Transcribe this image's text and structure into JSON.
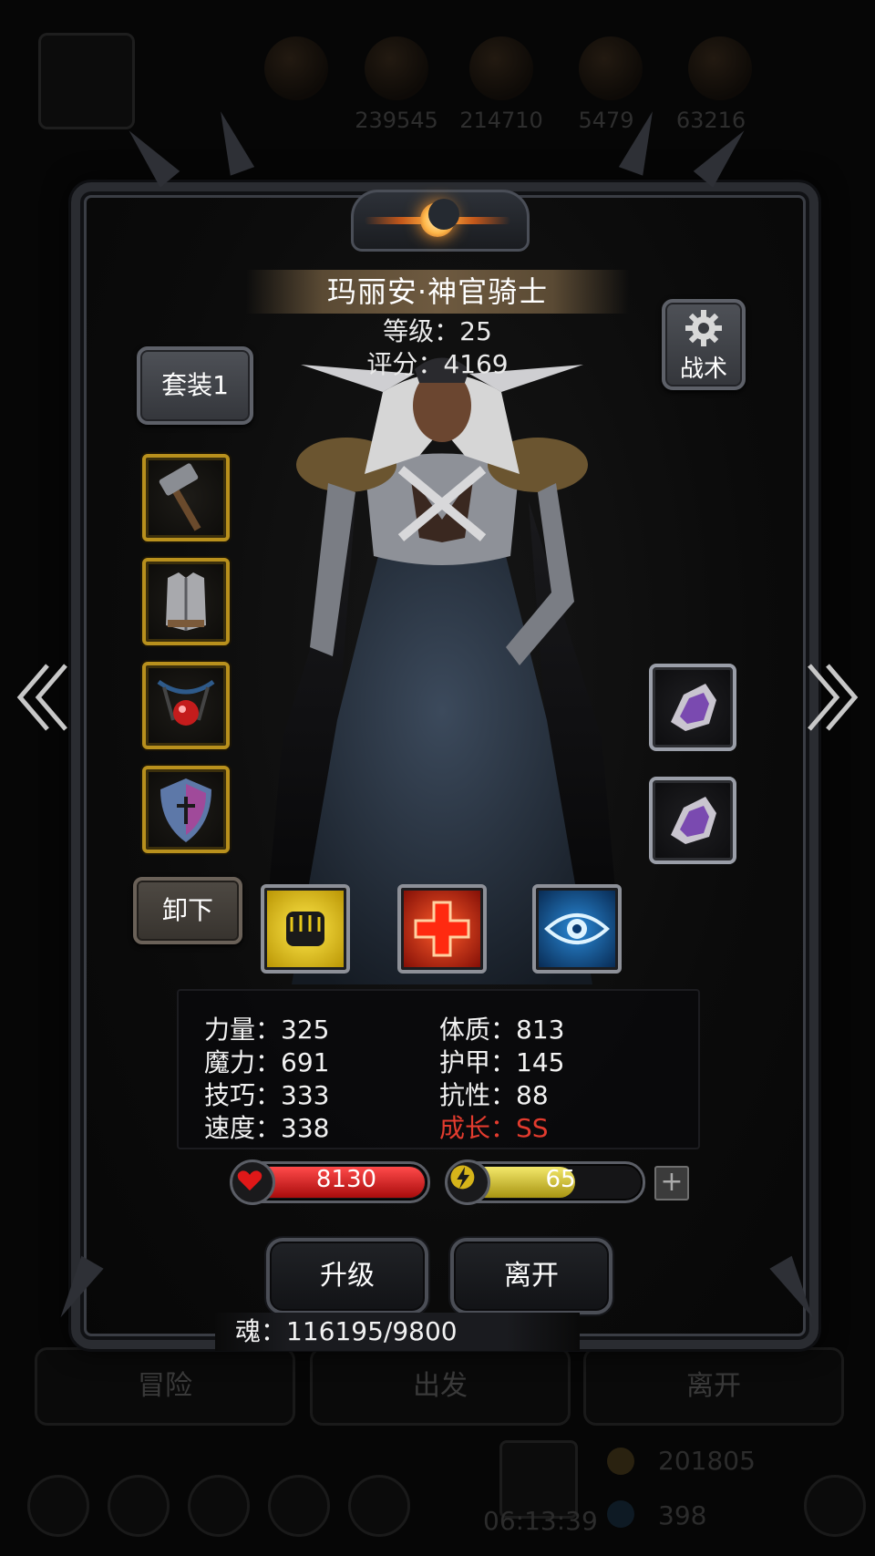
{
  "background": {
    "resources": [
      "239545",
      "214710",
      "5479",
      "63216"
    ],
    "tabs": [
      "冒险",
      "出发",
      "离开"
    ],
    "gold": "201805",
    "timer": "06:13:39",
    "gems": "398"
  },
  "character": {
    "name": "玛丽安·神官骑士",
    "level_line": "等级：25",
    "score_line": "评分：4169"
  },
  "buttons": {
    "set": "套装1",
    "tactics": "战术",
    "unequip": "卸下",
    "upgrade": "升级",
    "leave": "离开"
  },
  "equipment_icons": [
    "hammer-icon",
    "chest-armor-icon",
    "amulet-icon",
    "shield-icon"
  ],
  "gem_icons": [
    "amethyst-crystal-icon",
    "amethyst-crystal-icon"
  ],
  "skills": [
    "fist-skill-icon",
    "heal-cross-skill-icon",
    "eye-skill-icon"
  ],
  "stats": {
    "left": [
      "力量：325",
      "魔力：691",
      "技巧：333",
      "速度：338"
    ],
    "right": [
      "体质：813",
      "护甲：145",
      "抗性：88",
      "成长：SS"
    ]
  },
  "bars": {
    "hp": {
      "value": "8130",
      "fill": 1.0,
      "color": "#c41414"
    },
    "energy": {
      "value": "65",
      "fill": 0.65,
      "color": "#d7c521"
    }
  },
  "soul": "魂：116195/9800",
  "colors": {
    "accent_gold": "#b8901d",
    "growth_red": "#e23b2e"
  }
}
